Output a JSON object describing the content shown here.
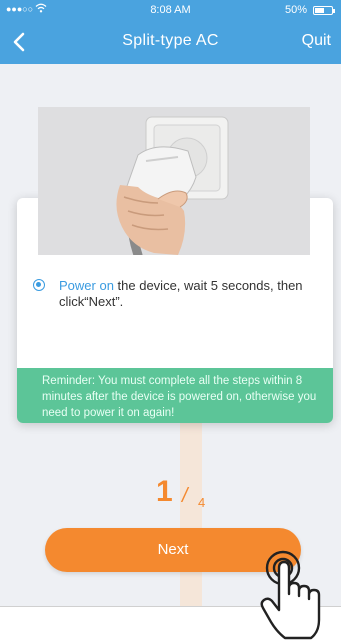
{
  "status_bar": {
    "signal": "●●●○○",
    "time": "8:08 AM",
    "battery_pct": "50%"
  },
  "nav": {
    "title": "Split-type AC",
    "quit_label": "Quit",
    "back_icon": "chevron-left-icon"
  },
  "card": {
    "instruction_highlight": "Power on",
    "instruction_rest": " the device, wait 5 seconds, then click“Next”.",
    "reminder": "Reminder: You must complete all the steps within 8 minutes after the device is powered on, otherwise you need to power it on again!"
  },
  "step": {
    "current": "1",
    "slash": "/",
    "total": "4"
  },
  "next_label": "Next",
  "colors": {
    "header": "#4aa3df",
    "accent_blue": "#3a9be0",
    "reminder_green": "#5cc598",
    "orange": "#f4892f"
  }
}
